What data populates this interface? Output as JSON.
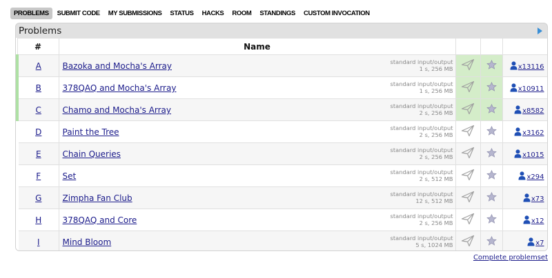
{
  "nav": {
    "tabs": [
      {
        "label": "PROBLEMS",
        "active": true
      },
      {
        "label": "SUBMIT CODE"
      },
      {
        "label": "MY SUBMISSIONS"
      },
      {
        "label": "STATUS"
      },
      {
        "label": "HACKS"
      },
      {
        "label": "ROOM"
      },
      {
        "label": "STANDINGS"
      },
      {
        "label": "CUSTOM INVOCATION"
      }
    ]
  },
  "panel": {
    "title": "Problems",
    "columns": {
      "index": "#",
      "name": "Name"
    }
  },
  "problems": [
    {
      "index": "A",
      "name": "Bazoka and Mocha's Array",
      "io": "standard input/output",
      "limits": "1 s, 256 MB",
      "solved": "x13116",
      "accepted": true
    },
    {
      "index": "B",
      "name": "378QAQ and Mocha's Array",
      "io": "standard input/output",
      "limits": "1 s, 256 MB",
      "solved": "x10911",
      "accepted": true
    },
    {
      "index": "C",
      "name": "Chamo and Mocha's Array",
      "io": "standard input/output",
      "limits": "2 s, 256 MB",
      "solved": "x8582",
      "accepted": true
    },
    {
      "index": "D",
      "name": "Paint the Tree",
      "io": "standard input/output",
      "limits": "2 s, 256 MB",
      "solved": "x3162",
      "accepted": false
    },
    {
      "index": "E",
      "name": "Chain Queries",
      "io": "standard input/output",
      "limits": "2 s, 256 MB",
      "solved": "x1015",
      "accepted": false
    },
    {
      "index": "F",
      "name": "Set",
      "io": "standard input/output",
      "limits": "2 s, 512 MB",
      "solved": "x294",
      "accepted": false
    },
    {
      "index": "G",
      "name": "Zimpha Fan Club",
      "io": "standard input/output",
      "limits": "12 s, 512 MB",
      "solved": "x73",
      "accepted": false
    },
    {
      "index": "H",
      "name": "378QAQ and Core",
      "io": "standard input/output",
      "limits": "2 s, 256 MB",
      "solved": "x12",
      "accepted": false
    },
    {
      "index": "I",
      "name": "Mind Bloom",
      "io": "standard input/output",
      "limits": "5 s, 1024 MB",
      "solved": "x7",
      "accepted": false
    }
  ],
  "footer": {
    "complete_link": "Complete problemset"
  },
  "colors": {
    "accepted": "#aee0a4",
    "link": "#1a1a8a",
    "user_icon": "#1f4fb5"
  }
}
